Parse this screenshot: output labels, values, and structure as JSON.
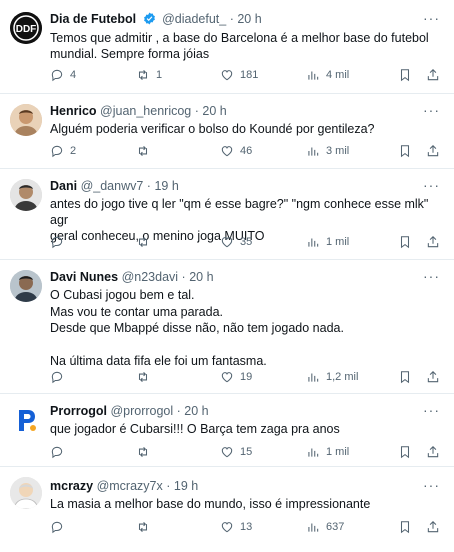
{
  "tweets": [
    {
      "name": "Dia de Futebol",
      "verified": true,
      "handle": "@diadefut_",
      "dot": "·",
      "time": "20 h",
      "text": "Temos que admitir , a base do Barcelona é a melhor base do futebol\nmundial. Sempre forma jóias",
      "replies": "4",
      "retweets": "1",
      "likes": "181",
      "views": "4 mil",
      "avatar_icon": "ddf-logo"
    },
    {
      "name": "Henrico",
      "verified": false,
      "handle": "@juan_henricog",
      "dot": "·",
      "time": "20 h",
      "text": "Alguém poderia verificar o bolso do Koundé por gentileza?",
      "replies": "2",
      "retweets": "",
      "likes": "46",
      "views": "3 mil",
      "avatar_icon": "user-photo"
    },
    {
      "name": "Dani",
      "verified": false,
      "handle": "@_danwv7",
      "dot": "·",
      "time": "19 h",
      "text": "antes do jogo tive q ler \"qm é esse bagre?\" \"ngm conhece esse mlk\" agr\ngeral conheceu, o menino joga MUITO",
      "replies": "",
      "retweets": "",
      "likes": "35",
      "views": "1 mil",
      "avatar_icon": "user-photo"
    },
    {
      "name": "Davi Nunes",
      "verified": false,
      "handle": "@n23davi",
      "dot": "·",
      "time": "20 h",
      "text": "O Cubasi jogou bem e tal.\nMas vou te contar uma parada.\nDesde que Mbappé disse não, não tem jogado nada.\n\nNa última data fifa ele foi um fantasma.",
      "replies": "",
      "retweets": "",
      "likes": "19",
      "views": "1,2 mil",
      "avatar_icon": "user-photo"
    },
    {
      "name": "Prorrogol",
      "verified": false,
      "handle": "@prorrogol",
      "dot": "·",
      "time": "20 h",
      "text": "que jogador é Cubarsi!!! O Barça tem zaga pra anos",
      "replies": "",
      "retweets": "",
      "likes": "15",
      "views": "1 mil",
      "avatar_icon": "prorrogol-logo"
    },
    {
      "name": "mcrazy",
      "verified": false,
      "handle": "@mcrazy7x",
      "dot": "·",
      "time": "19 h",
      "text": "La masia a melhor base do mundo, isso é impressionante",
      "replies": "",
      "retweets": "",
      "likes": "13",
      "views": "637",
      "avatar_icon": "user-photo"
    }
  ],
  "more_glyph": "···",
  "colors": {
    "text": "#0f1419",
    "muted": "#536471",
    "verified": "#1d9bf0",
    "divider": "#e6ecf0"
  }
}
